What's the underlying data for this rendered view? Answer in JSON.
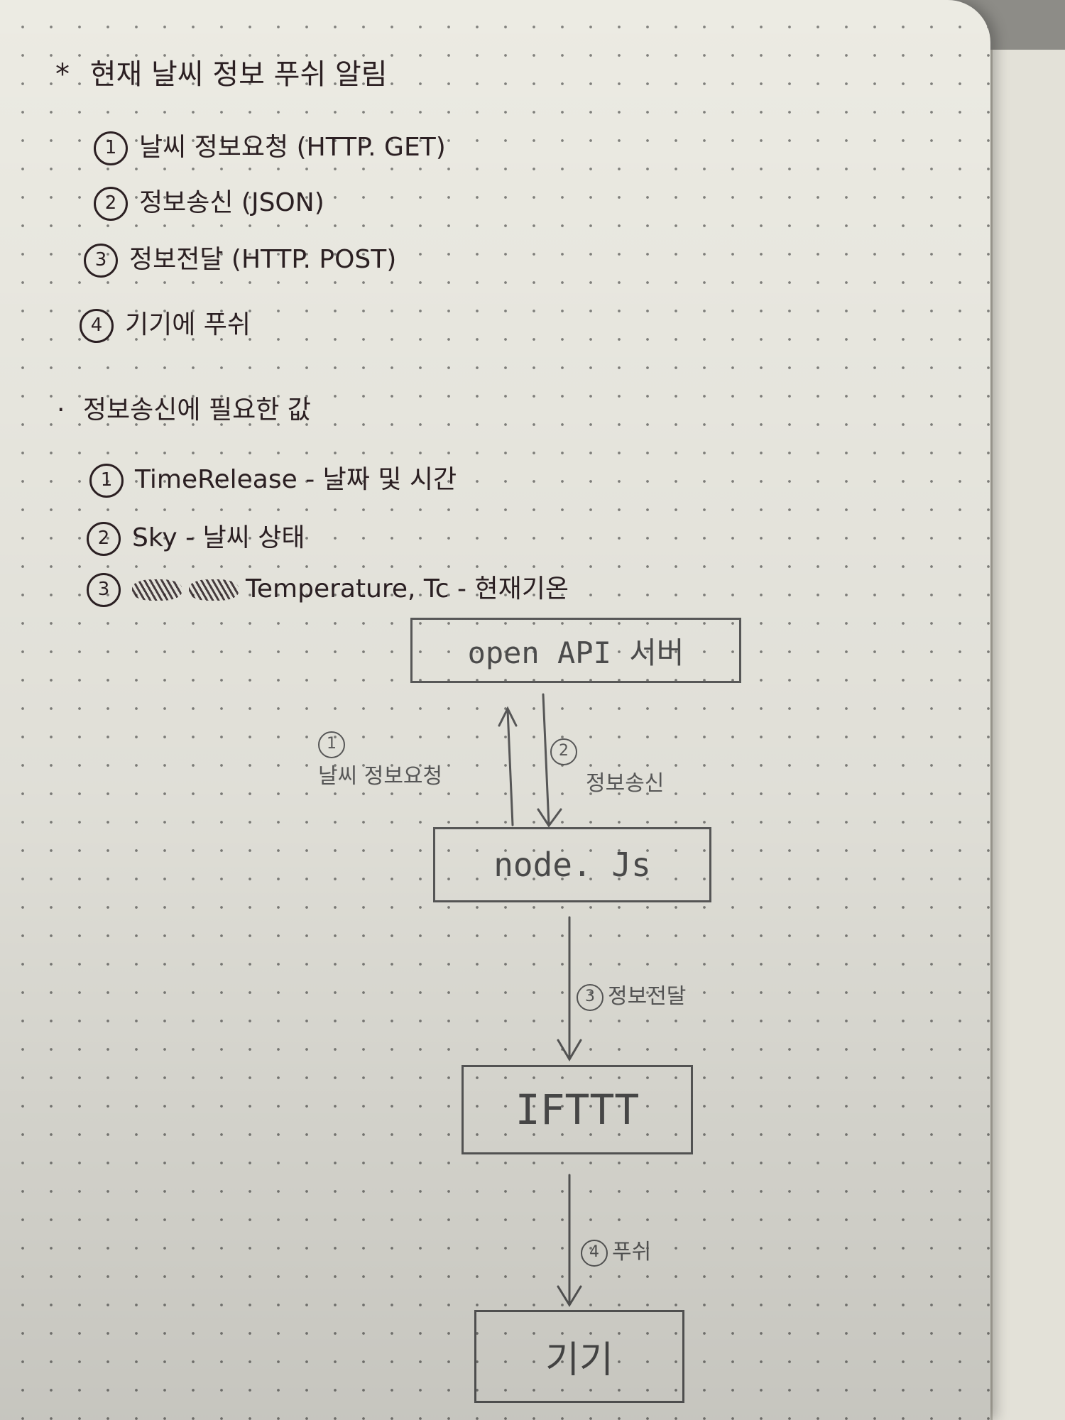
{
  "notes": {
    "title_mark": "*",
    "title": "현재 날씨 정보 푸쉬 알림",
    "steps": [
      {
        "num": "1",
        "text": "날씨 정보요청 (HTTP. GET)"
      },
      {
        "num": "2",
        "text": "정보송신 (JSON)"
      },
      {
        "num": "3",
        "text": "정보전달 (HTTP. POST)"
      },
      {
        "num": "4",
        "text": "기기에 푸쉬"
      }
    ],
    "values_bullet": "·",
    "values_heading": "정보송신에 필요한 값",
    "values": [
      {
        "num": "1",
        "text": "TimeRelease - 날짜 및 시간"
      },
      {
        "num": "2",
        "text": "Sky - 날씨 상태"
      },
      {
        "num": "3",
        "text": "Temperature, Tc - 현재기온"
      }
    ]
  },
  "diagram": {
    "nodes": {
      "open_api": "open API 서버",
      "nodejs": "node. Js",
      "ifttt": "IFTTT",
      "device": "기기"
    },
    "edges": [
      {
        "num": "1",
        "label": "날씨 정보요청"
      },
      {
        "num": "2",
        "label": "정보송신"
      },
      {
        "num": "3",
        "label": "정보전달"
      },
      {
        "num": "4",
        "label": "푸쉬"
      }
    ]
  }
}
